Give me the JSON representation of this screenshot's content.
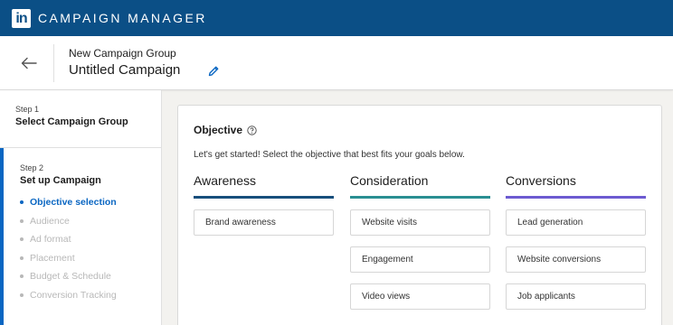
{
  "topbar": {
    "logo": "in",
    "brand": "CAMPAIGN MANAGER"
  },
  "header": {
    "subtitle": "New Campaign Group",
    "title": "Untitled Campaign"
  },
  "sidebar": {
    "step1": {
      "label": "Step 1",
      "title": "Select Campaign Group"
    },
    "step2": {
      "label": "Step 2",
      "title": "Set up Campaign",
      "items": [
        {
          "label": "Objective selection"
        },
        {
          "label": "Audience"
        },
        {
          "label": "Ad format"
        },
        {
          "label": "Placement"
        },
        {
          "label": "Budget & Schedule"
        },
        {
          "label": "Conversion Tracking"
        }
      ]
    }
  },
  "objective": {
    "title": "Objective",
    "description": "Let's get started! Select the objective that best fits your goals below.",
    "columns": [
      {
        "heading": "Awareness",
        "color": "#174f7c",
        "options": [
          "Brand awareness"
        ]
      },
      {
        "heading": "Consideration",
        "color": "#2a8f92",
        "options": [
          "Website visits",
          "Engagement",
          "Video views"
        ]
      },
      {
        "heading": "Conversions",
        "color": "#6c5bd1",
        "options": [
          "Lead generation",
          "Website conversions",
          "Job applicants"
        ]
      }
    ]
  },
  "colors": {
    "topbar": "#0b4f86",
    "accent": "#0a66c2"
  }
}
